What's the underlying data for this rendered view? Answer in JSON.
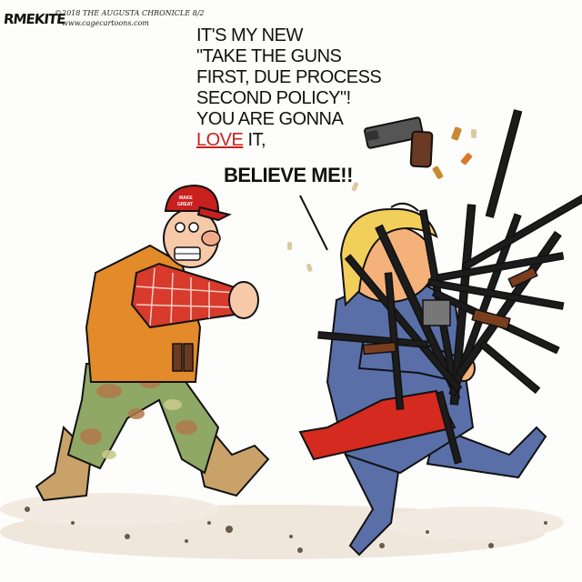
{
  "credit": {
    "signature": "RMEKITE",
    "copyright": "©2018 THE AUGUSTA CHRONICLE 8/2",
    "website": "www.cagecartoons.com"
  },
  "speech": {
    "line1": "IT'S MY NEW",
    "line2": "\"TAKE THE GUNS",
    "line3": "FIRST, DUE PROCESS",
    "line4": "SECOND POLICY\"!",
    "line5": "YOU ARE GONNA",
    "emphasis": "LOVE",
    "after_emphasis": "IT,",
    "line7": "BELIEVE ME!!"
  },
  "hat_text": "MAKE AMERICA GREAT",
  "colors": {
    "love": "#c8201e",
    "cap": "#c8201e",
    "vest": "#e38a2a",
    "shirt_plaid": "#d83a2c",
    "camo_base": "#8fa866",
    "suit": "#5a6fa8",
    "tie": "#d42a20",
    "hair": "#f2cf5a",
    "ground": "#efe3d6"
  }
}
